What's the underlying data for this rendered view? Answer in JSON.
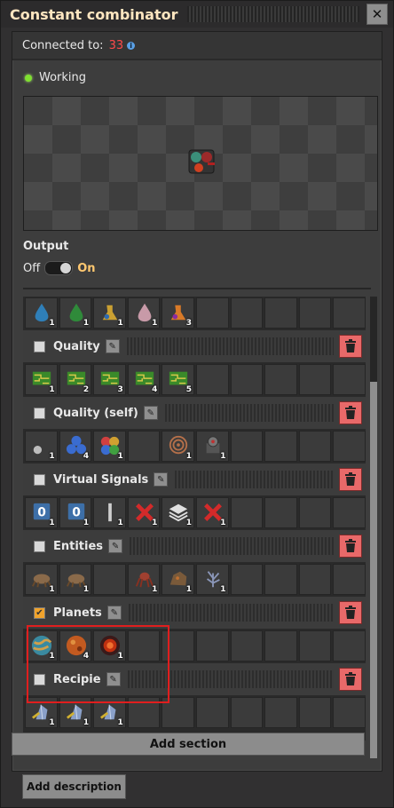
{
  "window": {
    "title": "Constant combinator",
    "close_label": "✕"
  },
  "connection": {
    "label": "Connected to:",
    "value": "33",
    "info_icon": "info-icon"
  },
  "status": {
    "text": "Working",
    "color": "#7fe030"
  },
  "output": {
    "label": "Output",
    "off": "Off",
    "on": "On",
    "state": "on"
  },
  "sections": [
    {
      "name": "top",
      "header": null,
      "slots": [
        {
          "icon": "blue-drop",
          "count": "1"
        },
        {
          "icon": "green-drop",
          "count": "1"
        },
        {
          "icon": "gold-mixture",
          "count": "1"
        },
        {
          "icon": "pink-drop",
          "count": "1"
        },
        {
          "icon": "orange-mixture",
          "count": "3"
        }
      ]
    },
    {
      "name": "quality",
      "header": {
        "title": "Quality",
        "checked": false
      },
      "slots": [
        {
          "icon": "circuit",
          "count": "1"
        },
        {
          "icon": "circuit",
          "count": "2"
        },
        {
          "icon": "circuit",
          "count": "3"
        },
        {
          "icon": "circuit",
          "count": "4"
        },
        {
          "icon": "circuit",
          "count": "5"
        }
      ]
    },
    {
      "name": "quality-self",
      "header": {
        "title": "Quality (self)",
        "checked": false
      },
      "slots": [
        {
          "icon": "dot",
          "count": "1"
        },
        {
          "icon": "blue-cluster",
          "count": "4"
        },
        {
          "icon": "rgb-cluster",
          "count": "1"
        },
        {
          "icon": "",
          "count": ""
        },
        {
          "icon": "coil",
          "count": "1"
        },
        {
          "icon": "gear-machine",
          "count": "1"
        }
      ]
    },
    {
      "name": "virtual-signals",
      "header": {
        "title": "Virtual Signals",
        "checked": false
      },
      "slots": [
        {
          "icon": "zero-signal",
          "count": "1"
        },
        {
          "icon": "zero-signal",
          "count": "1"
        },
        {
          "icon": "bar-signal",
          "count": "1"
        },
        {
          "icon": "red-x",
          "count": "1"
        },
        {
          "icon": "layers",
          "count": "1"
        },
        {
          "icon": "red-x",
          "count": "1"
        }
      ]
    },
    {
      "name": "entities",
      "header": {
        "title": "Entities",
        "checked": false
      },
      "slots": [
        {
          "icon": "bug",
          "count": "1"
        },
        {
          "icon": "bug",
          "count": "1"
        },
        {
          "icon": "",
          "count": ""
        },
        {
          "icon": "spider",
          "count": "1"
        },
        {
          "icon": "rock",
          "count": "1"
        },
        {
          "icon": "plant",
          "count": "1"
        }
      ]
    },
    {
      "name": "planets",
      "header": {
        "title": "Planets",
        "checked": true
      },
      "slots": [
        {
          "icon": "planet-teal",
          "count": "1"
        },
        {
          "icon": "planet-orange",
          "count": "4"
        },
        {
          "icon": "planet-red",
          "count": "1"
        }
      ]
    },
    {
      "name": "recipie",
      "header": {
        "title": "Recipie",
        "checked": false
      },
      "slots": [
        {
          "icon": "crystal",
          "count": "1"
        },
        {
          "icon": "crystal",
          "count": "1"
        },
        {
          "icon": "crystal",
          "count": "1"
        }
      ]
    }
  ],
  "buttons": {
    "add_section": "Add section",
    "add_description": "Add description"
  },
  "colors": {
    "accent": "#ffc870",
    "danger": "#e86969",
    "highlight": "#e01e1e",
    "count_alert": "#ff4a4a"
  }
}
